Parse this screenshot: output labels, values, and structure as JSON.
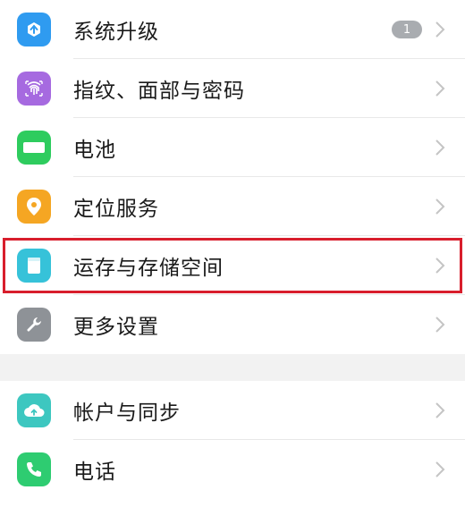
{
  "colors": {
    "system_update": "#2f9bf0",
    "fingerprint": "#a66ae0",
    "battery": "#2ecc5e",
    "location": "#f5a623",
    "storage": "#36c2d9",
    "more_settings": "#8e9297",
    "accounts": "#3dc7c0",
    "phone": "#2ecc71",
    "highlight": "#d81e2c",
    "badge": "#a9acb0"
  },
  "settings": {
    "group1": [
      {
        "label": "系统升级",
        "icon": "system-update-icon",
        "badge": "1"
      },
      {
        "label": "指纹、面部与密码",
        "icon": "fingerprint-icon"
      },
      {
        "label": "电池",
        "icon": "battery-icon"
      },
      {
        "label": "定位服务",
        "icon": "location-icon"
      },
      {
        "label": "运存与存储空间",
        "icon": "storage-icon",
        "highlighted": true
      },
      {
        "label": "更多设置",
        "icon": "wrench-icon"
      }
    ],
    "group2": [
      {
        "label": "帐户与同步",
        "icon": "cloud-sync-icon"
      },
      {
        "label": "电话",
        "icon": "phone-icon"
      }
    ]
  }
}
